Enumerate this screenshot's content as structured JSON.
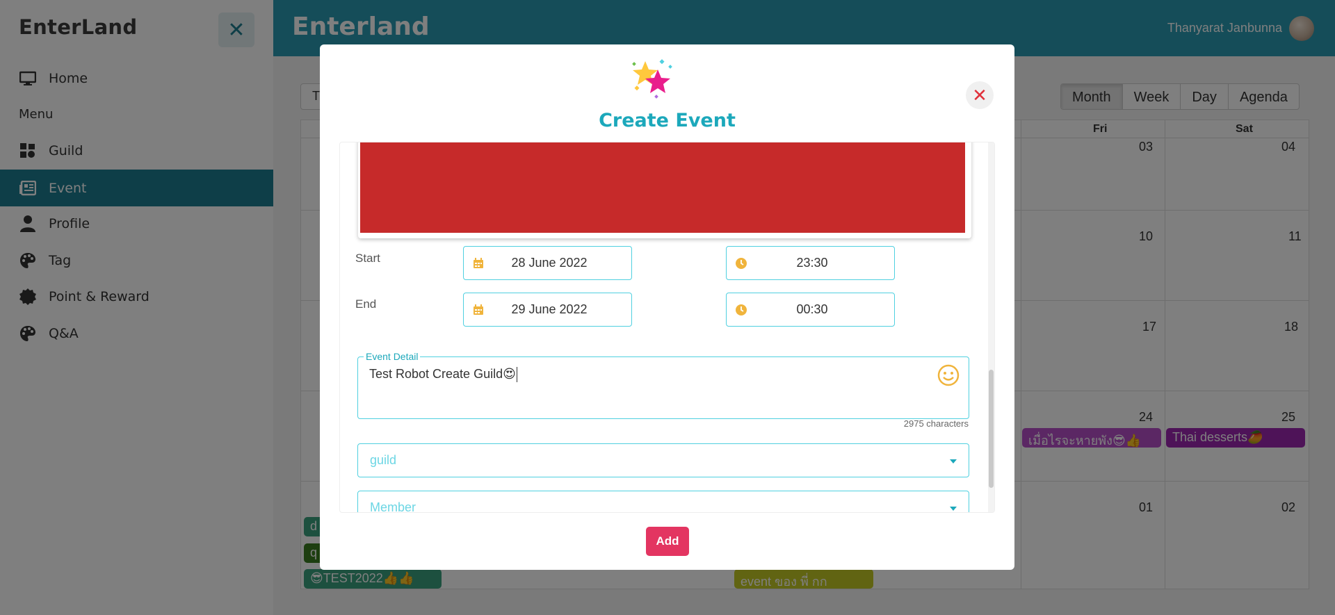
{
  "sidebar": {
    "brand": "EnterLand",
    "collapse_icon": "close-icon",
    "menu_label": "Menu",
    "items": [
      {
        "label": "Home",
        "icon": "monitor-icon"
      },
      {
        "label": "Guild",
        "icon": "guild-icon"
      },
      {
        "label": "Event",
        "icon": "newspaper-icon",
        "active": true
      },
      {
        "label": "Profile",
        "icon": "user-icon"
      },
      {
        "label": "Tag",
        "icon": "palette-icon"
      },
      {
        "label": "Point & Reward",
        "icon": "badge-icon"
      },
      {
        "label": "Q&A",
        "icon": "palette-icon"
      }
    ],
    "active_color": "#1d7d91"
  },
  "header": {
    "title": "Enterland",
    "user_name": "Thanyarat Janbunna",
    "bg_color": "#2a9bb3"
  },
  "calendar": {
    "left_button": "T",
    "views": [
      "Month",
      "Week",
      "Day",
      "Agenda"
    ],
    "day_names": [
      "Fri",
      "Sat"
    ],
    "dates": [
      "03",
      "04",
      "10",
      "11",
      "17",
      "18",
      "24",
      "25",
      "01",
      "02"
    ],
    "events": [
      {
        "label": "เมื่อไรจะหายพัง😎👍",
        "color": "#b64fc8"
      },
      {
        "label": "Thai desserts🥭",
        "color": "#9c27b0"
      },
      {
        "label": "d",
        "color": "#3aa17e"
      },
      {
        "label": "q",
        "color": "#3a7d21"
      },
      {
        "label": "😎TEST2022👍👍",
        "color": "#3aa17e"
      },
      {
        "label": "event ของ พี่ กก",
        "color": "#c2c824"
      }
    ]
  },
  "modal": {
    "title": "Create Event",
    "close_icon": "close-icon",
    "cover_color": "#c62a2a",
    "start": {
      "label": "Start",
      "date": "28 June 2022",
      "time": "23:30"
    },
    "end": {
      "label": "End",
      "date": "29 June 2022",
      "time": "00:30"
    },
    "detail": {
      "legend": "Event Detail",
      "value": "Test Robot Create Guild😍",
      "count": "2975 characters"
    },
    "guild_placeholder": "guild",
    "member_placeholder": "Member",
    "add_label": "Add",
    "accent": "#1ca8bb",
    "add_color": "#e33561"
  }
}
